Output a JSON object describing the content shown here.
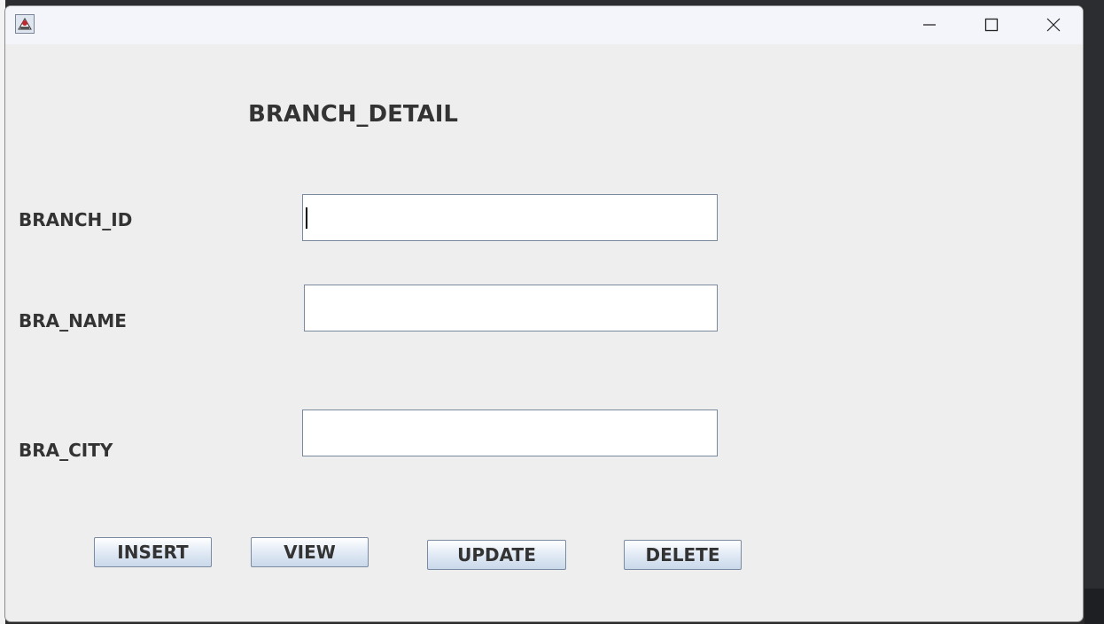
{
  "window": {
    "icon": "java-app-icon",
    "controls": {
      "minimize": "minimize-icon",
      "maximize": "maximize-icon",
      "close": "close-icon"
    }
  },
  "form": {
    "title": "BRANCH_DETAIL",
    "fields": [
      {
        "label": "BRANCH_ID",
        "value": ""
      },
      {
        "label": "BRA_NAME",
        "value": ""
      },
      {
        "label": "BRA_CITY",
        "value": ""
      }
    ],
    "buttons": {
      "insert": "INSERT",
      "view": "VIEW",
      "update": "UPDATE",
      "delete": "DELETE"
    }
  },
  "colors": {
    "window_bg": "#eeeeee",
    "titlebar_bg": "#f3f5fa",
    "text": "#333333",
    "button_gradient_top": "#ffffff",
    "button_gradient_bottom": "#c9d8ea"
  }
}
